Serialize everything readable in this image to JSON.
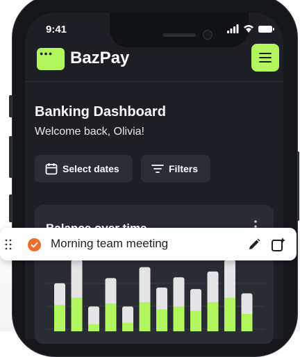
{
  "status_bar": {
    "time": "9:41"
  },
  "app": {
    "brand": "BazPay",
    "logo_icon": "wallet-icon",
    "menu_icon": "hamburger-icon"
  },
  "dashboard": {
    "title": "Banking Dashboard",
    "welcome": "Welcome back, Olivia!",
    "select_dates_label": "Select dates",
    "filters_label": "Filters"
  },
  "balance_card": {
    "title": "Balance over time"
  },
  "chart_data": {
    "type": "bar",
    "title": "Balance over time",
    "colors": {
      "primary": "#b2f65e",
      "secondary": "#e4e4e7"
    },
    "series": [
      {
        "values": [
          30,
          52,
          24,
          35,
          22,
          48,
          30,
          40,
          30,
          42,
          52,
          28
        ]
      },
      {
        "values": [
          36,
          46,
          10,
          38,
          12,
          40,
          30,
          34,
          28,
          40,
          46,
          24
        ]
      }
    ]
  },
  "task_bar": {
    "text": "Morning team meeting",
    "status_color": "#f06b2a",
    "edit_icon": "pencil-icon",
    "add_icon": "add-note-icon"
  }
}
